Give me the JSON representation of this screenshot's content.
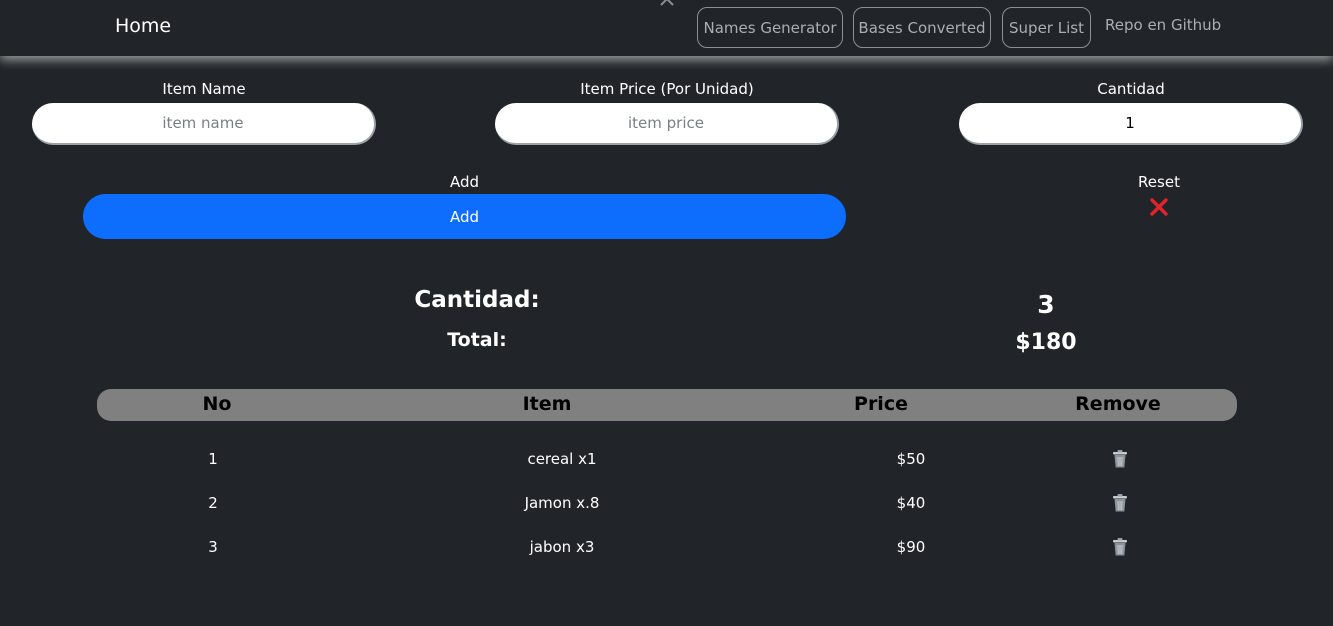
{
  "navbar": {
    "brand": "Home",
    "buttons": [
      "Names Generator",
      "Bases Converted",
      "Super List"
    ],
    "repo_link": "Repo en Github"
  },
  "form": {
    "item_name": {
      "label": "Item Name",
      "placeholder": "item name",
      "value": ""
    },
    "item_price": {
      "label": "Item Price (Por Unidad)",
      "placeholder": "item price",
      "value": ""
    },
    "quantity": {
      "label": "Cantidad",
      "value": "1"
    },
    "add_label": "Add",
    "add_button": "Add",
    "reset_label": "Reset"
  },
  "summary": {
    "quantity_label": "Cantidad:",
    "quantity_value": "3",
    "total_label": "Total:",
    "total_value": "$180"
  },
  "table": {
    "headers": [
      "No",
      "Item",
      "Price",
      "Remove"
    ],
    "rows": [
      {
        "no": "1",
        "item": "cereal x1",
        "price": "$50"
      },
      {
        "no": "2",
        "item": "Jamon x.8",
        "price": "$40"
      },
      {
        "no": "3",
        "item": "jabon x3",
        "price": "$90"
      }
    ]
  },
  "colors": {
    "background": "#212529",
    "accent": "#0d6efd",
    "reset": "#e0242a",
    "header_bar": "#808080"
  },
  "icons": {
    "reset": "cross-mark-icon",
    "remove": "trash-icon",
    "collapse": "chevron-up-icon"
  }
}
